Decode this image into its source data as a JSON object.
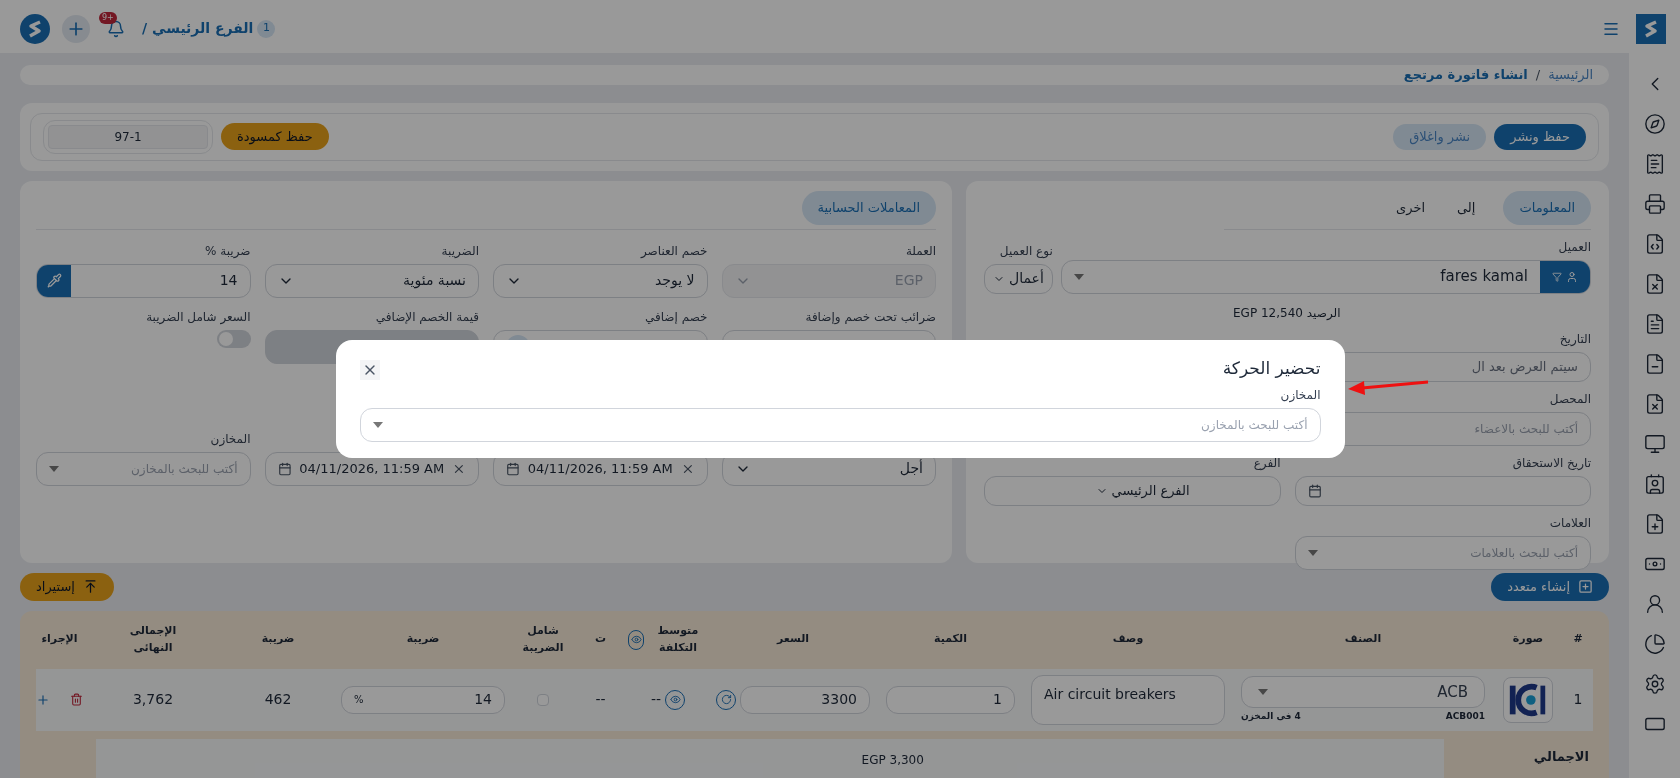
{
  "header": {
    "branch_count": "1",
    "branch": "الفرع الرئيسي /",
    "notifications": "+9"
  },
  "breadcrumb": {
    "separator": "/",
    "items": [
      {
        "label": "الرئيسية",
        "current": false
      },
      {
        "label": "انشاء فاتورة مرتجع",
        "current": true
      }
    ]
  },
  "toolbar": {
    "buttons": [
      {
        "label": "حفظ ونشر",
        "kind": "primary"
      },
      {
        "label": "نشر واغلاق",
        "kind": "secondary"
      }
    ],
    "draft_button": "حفظ كمسودة",
    "invoice_number": "97-1"
  },
  "info_panel": {
    "tabs": [
      {
        "label": "المعلومات",
        "selected": true
      },
      {
        "label": "إلى",
        "selected": false
      },
      {
        "label": "اخرى",
        "selected": false
      }
    ],
    "customer": {
      "label": "العميل",
      "value": "fares kamal"
    },
    "customer_type": {
      "label": "نوع العميل",
      "value": "أعمال"
    },
    "balance": "الرصيد EGP 12,540",
    "date": {
      "label": "التاريخ",
      "placeholder": "سيتم العرض بعد ال"
    },
    "collector": {
      "label": "المحصل",
      "placeholder": "أكتب للبحث بالاعضاء"
    },
    "due_date": {
      "label": "تاريخ الاستحقاق"
    },
    "branch": {
      "label": "الفرع",
      "value": "الفرع الرئيسي"
    },
    "tags": {
      "label": "العلامات",
      "placeholder": "أكتب للبحث بالعلامات"
    }
  },
  "accounting_panel": {
    "tab": {
      "label": "المعاملات الحسابية",
      "selected": true
    },
    "fields": [
      {
        "kind": "select",
        "label": "العملة",
        "value": "EGP",
        "disabled": true
      },
      {
        "kind": "select",
        "label": "خصم العناصر",
        "value": "لا يوجد",
        "disabled": false
      },
      {
        "kind": "select",
        "label": "الضريبة",
        "value": "نسبة مئوية",
        "disabled": false
      },
      {
        "kind": "picker",
        "label": "ضريبة %",
        "value": "14"
      },
      {
        "kind": "field",
        "label": "ضرائب تحت خصم وإضافة",
        "disabled": false
      },
      {
        "kind": "discount",
        "label": "خصم إضافي"
      },
      {
        "kind": "field",
        "label": "قيمة الخصم الإضافي",
        "disabled": true
      },
      {
        "kind": "toggle",
        "label": "السعر شامل الضريبة",
        "on": false
      },
      {
        "kind": "select",
        "value": "أجل",
        "disabled": false
      },
      {
        "kind": "date",
        "value": "04/11/2026, 11:59 AM"
      },
      {
        "kind": "date",
        "value": "04/11/2026, 11:59 AM"
      },
      {
        "kind": "search",
        "label": "المخازن",
        "placeholder": "أكتب للبحث بالمخازن"
      }
    ]
  },
  "item_buttons": {
    "create_multiple": "إنشاء متعدد",
    "import": "إستيراد"
  },
  "table": {
    "columns": [
      "#",
      "صورة",
      "الصنف",
      "وصف",
      "الكمية",
      "السعر",
      "متوسط التكلفة",
      "ت",
      "شامل الضريبة",
      "ضريبة",
      "ضريبة",
      "الإجمالى النهائى",
      "الإجراء"
    ],
    "rows": [
      {
        "index": "1",
        "item": "ACB",
        "code": "ACB001",
        "stock": "4 فى المخزن",
        "description": "Air circuit breakers",
        "quantity": "1",
        "price": "3300",
        "average_cost": "--",
        "column_8": "--",
        "tax_inclusive": false,
        "tax_rate": "14",
        "tax_unit": "%",
        "tax": "462",
        "total": "3,762"
      }
    ],
    "totals": {
      "label": "الاجمالي",
      "price": "EGP 3,300"
    }
  },
  "modal": {
    "title": "تحضير الحركة",
    "field_label": "المخازن",
    "placeholder": "أكتب للبحث بالمخازن"
  }
}
